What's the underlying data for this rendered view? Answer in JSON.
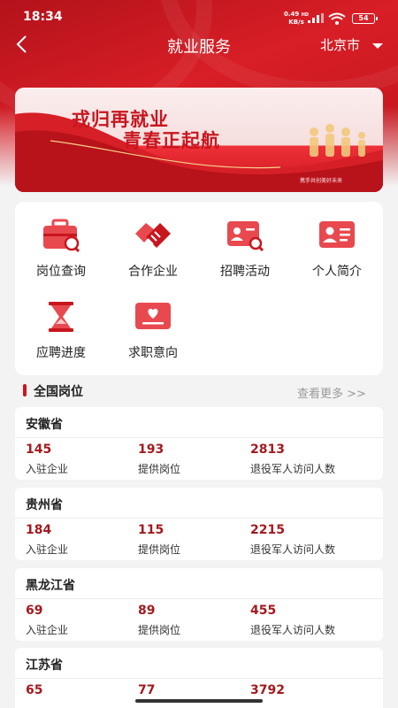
{
  "status": {
    "time": "18:34",
    "speed_value": "0.49",
    "speed_unit": "KB/s",
    "hd": "HD",
    "battery": "54"
  },
  "nav": {
    "title": "就业服务",
    "city": "北京市"
  },
  "banner": {
    "line1": "戎归再就业",
    "line2": "青春正起航",
    "slogan": "携手共创美好未来"
  },
  "grid": [
    {
      "label": "岗位查询",
      "icon": "briefcase-search-icon"
    },
    {
      "label": "合作企业",
      "icon": "handshake-icon"
    },
    {
      "label": "招聘活动",
      "icon": "id-card-search-icon"
    },
    {
      "label": "个人简介",
      "icon": "profile-card-icon"
    },
    {
      "label": "应聘进度",
      "icon": "hourglass-icon"
    },
    {
      "label": "求职意向",
      "icon": "heart-message-icon"
    }
  ],
  "section": {
    "title": "全国岗位",
    "more": "查看更多 >>"
  },
  "stat_labels": {
    "companies": "入驻企业",
    "positions": "提供岗位",
    "visitors": "退役军人访问人数"
  },
  "provinces": [
    {
      "name": "安徽省",
      "companies": "145",
      "positions": "193",
      "visitors": "2813"
    },
    {
      "name": "贵州省",
      "companies": "184",
      "positions": "115",
      "visitors": "2215"
    },
    {
      "name": "黑龙江省",
      "companies": "69",
      "positions": "89",
      "visitors": "455"
    },
    {
      "name": "江苏省",
      "companies": "65",
      "positions": "77",
      "visitors": "3792"
    }
  ],
  "colors": {
    "brand_red": "#c8161e",
    "number_red": "#a41a1f",
    "background": "#f3f3f3"
  }
}
